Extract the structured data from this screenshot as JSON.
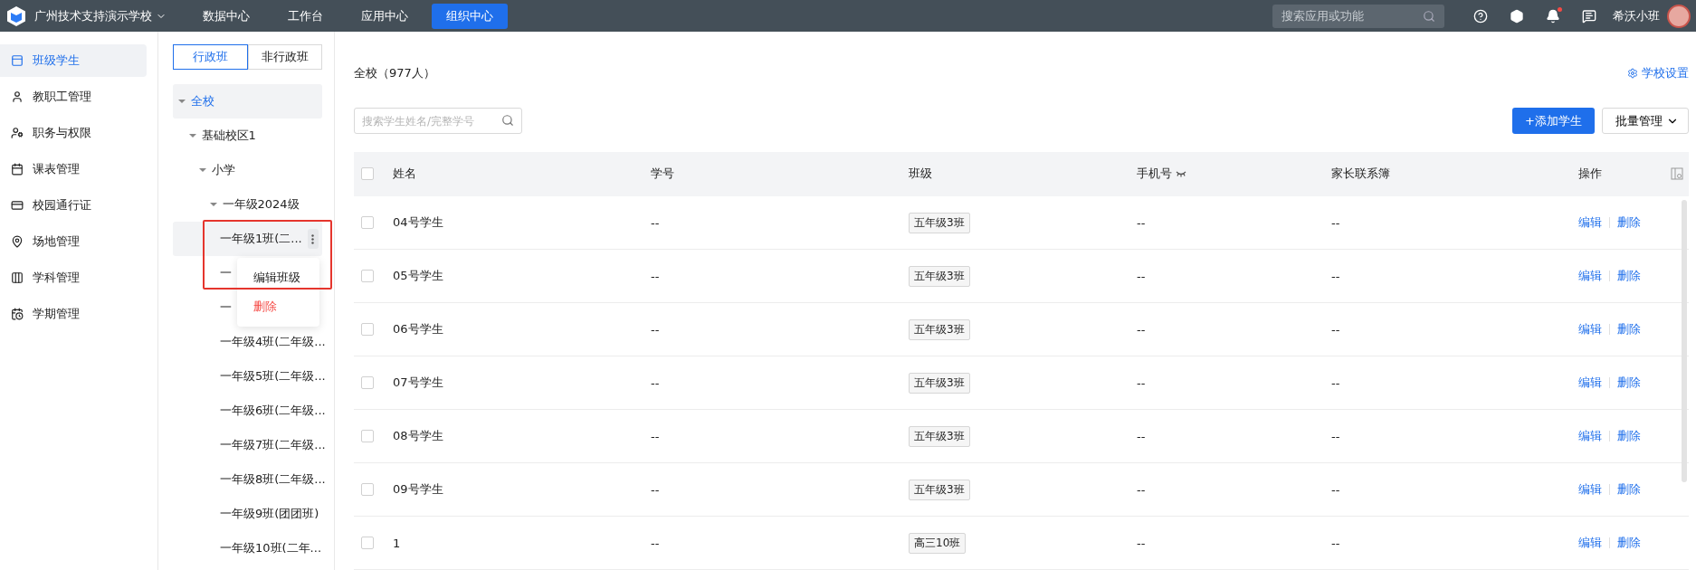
{
  "topbar": {
    "school": "广州技术支持演示学校",
    "nav": [
      {
        "label": "数据中心",
        "selected": false
      },
      {
        "label": "工作台",
        "selected": false
      },
      {
        "label": "应用中心",
        "selected": false
      },
      {
        "label": "组织中心",
        "selected": true
      }
    ],
    "search": {
      "placeholder": "搜索应用或功能"
    },
    "notification_dot": true,
    "user": "希沃小班"
  },
  "sidebar": {
    "items": [
      {
        "label": "班级学生",
        "selected": true
      },
      {
        "label": "教职工管理",
        "selected": false
      },
      {
        "label": "职务与权限",
        "selected": false
      },
      {
        "label": "课表管理",
        "selected": false
      },
      {
        "label": "校园通行证",
        "selected": false
      },
      {
        "label": "场地管理",
        "selected": false
      },
      {
        "label": "学科管理",
        "selected": false
      },
      {
        "label": "学期管理",
        "selected": false
      }
    ]
  },
  "tree_panel": {
    "tabs": [
      {
        "label": "行政班",
        "selected": true
      },
      {
        "label": "非行政班",
        "selected": false
      }
    ],
    "tree": [
      {
        "label": "全校",
        "selected": true,
        "expanded": true,
        "children": [
          {
            "label": "基础校区1",
            "selected": false,
            "expanded": true,
            "children": [
              {
                "label": "小学",
                "selected": false,
                "expanded": true,
                "children": [
                  {
                    "label": "一年级2024级",
                    "selected": false,
                    "expanded": true,
                    "children": [
                      {
                        "label": "一年级1班(二...",
                        "selected": false,
                        "hovered": true
                      },
                      {
                        "label": "一",
                        "selected": false
                      },
                      {
                        "label": "一",
                        "selected": false
                      },
                      {
                        "label": "一年级4班(二年级...",
                        "selected": false
                      },
                      {
                        "label": "一年级5班(二年级...",
                        "selected": false
                      },
                      {
                        "label": "一年级6班(二年级...",
                        "selected": false
                      },
                      {
                        "label": "一年级7班(二年级...",
                        "selected": false
                      },
                      {
                        "label": "一年级8班(二年级...",
                        "selected": false
                      },
                      {
                        "label": "一年级9班(团团班)",
                        "selected": false
                      },
                      {
                        "label": "一年级10班(二年...",
                        "selected": false
                      }
                    ]
                  }
                ]
              }
            ]
          }
        ]
      }
    ],
    "context_menu": [
      {
        "label": "编辑班级",
        "kind": "normal"
      },
      {
        "label": "删除",
        "kind": "danger"
      }
    ]
  },
  "main": {
    "title": "全校（977人）",
    "settings_link": "学校设置",
    "search": {
      "placeholder": "搜索学生姓名/完整学号"
    },
    "add_button": "+添加学生",
    "batch_button": "批量管理",
    "table": {
      "all_checked": false,
      "columns": [
        "姓名",
        "学号",
        "班级",
        "手机号",
        "家长联系簿",
        "操作"
      ],
      "rows": [
        {
          "name": "04号学生",
          "id": "--",
          "class": "五年级3班",
          "phone": "--",
          "parent": "--",
          "actions": [
            "编辑",
            "删除"
          ],
          "checked": false
        },
        {
          "name": "05号学生",
          "id": "--",
          "class": "五年级3班",
          "phone": "--",
          "parent": "--",
          "actions": [
            "编辑",
            "删除"
          ],
          "checked": false
        },
        {
          "name": "06号学生",
          "id": "--",
          "class": "五年级3班",
          "phone": "--",
          "parent": "--",
          "actions": [
            "编辑",
            "删除"
          ],
          "checked": false
        },
        {
          "name": "07号学生",
          "id": "--",
          "class": "五年级3班",
          "phone": "--",
          "parent": "--",
          "actions": [
            "编辑",
            "删除"
          ],
          "checked": false
        },
        {
          "name": "08号学生",
          "id": "--",
          "class": "五年级3班",
          "phone": "--",
          "parent": "--",
          "actions": [
            "编辑",
            "删除"
          ],
          "checked": false
        },
        {
          "name": "09号学生",
          "id": "--",
          "class": "五年级3班",
          "phone": "--",
          "parent": "--",
          "actions": [
            "编辑",
            "删除"
          ],
          "checked": false
        },
        {
          "name": "1",
          "id": "--",
          "class": "高三10班",
          "phone": "--",
          "parent": "--",
          "actions": [
            "编辑",
            "删除"
          ],
          "checked": false
        }
      ]
    }
  }
}
